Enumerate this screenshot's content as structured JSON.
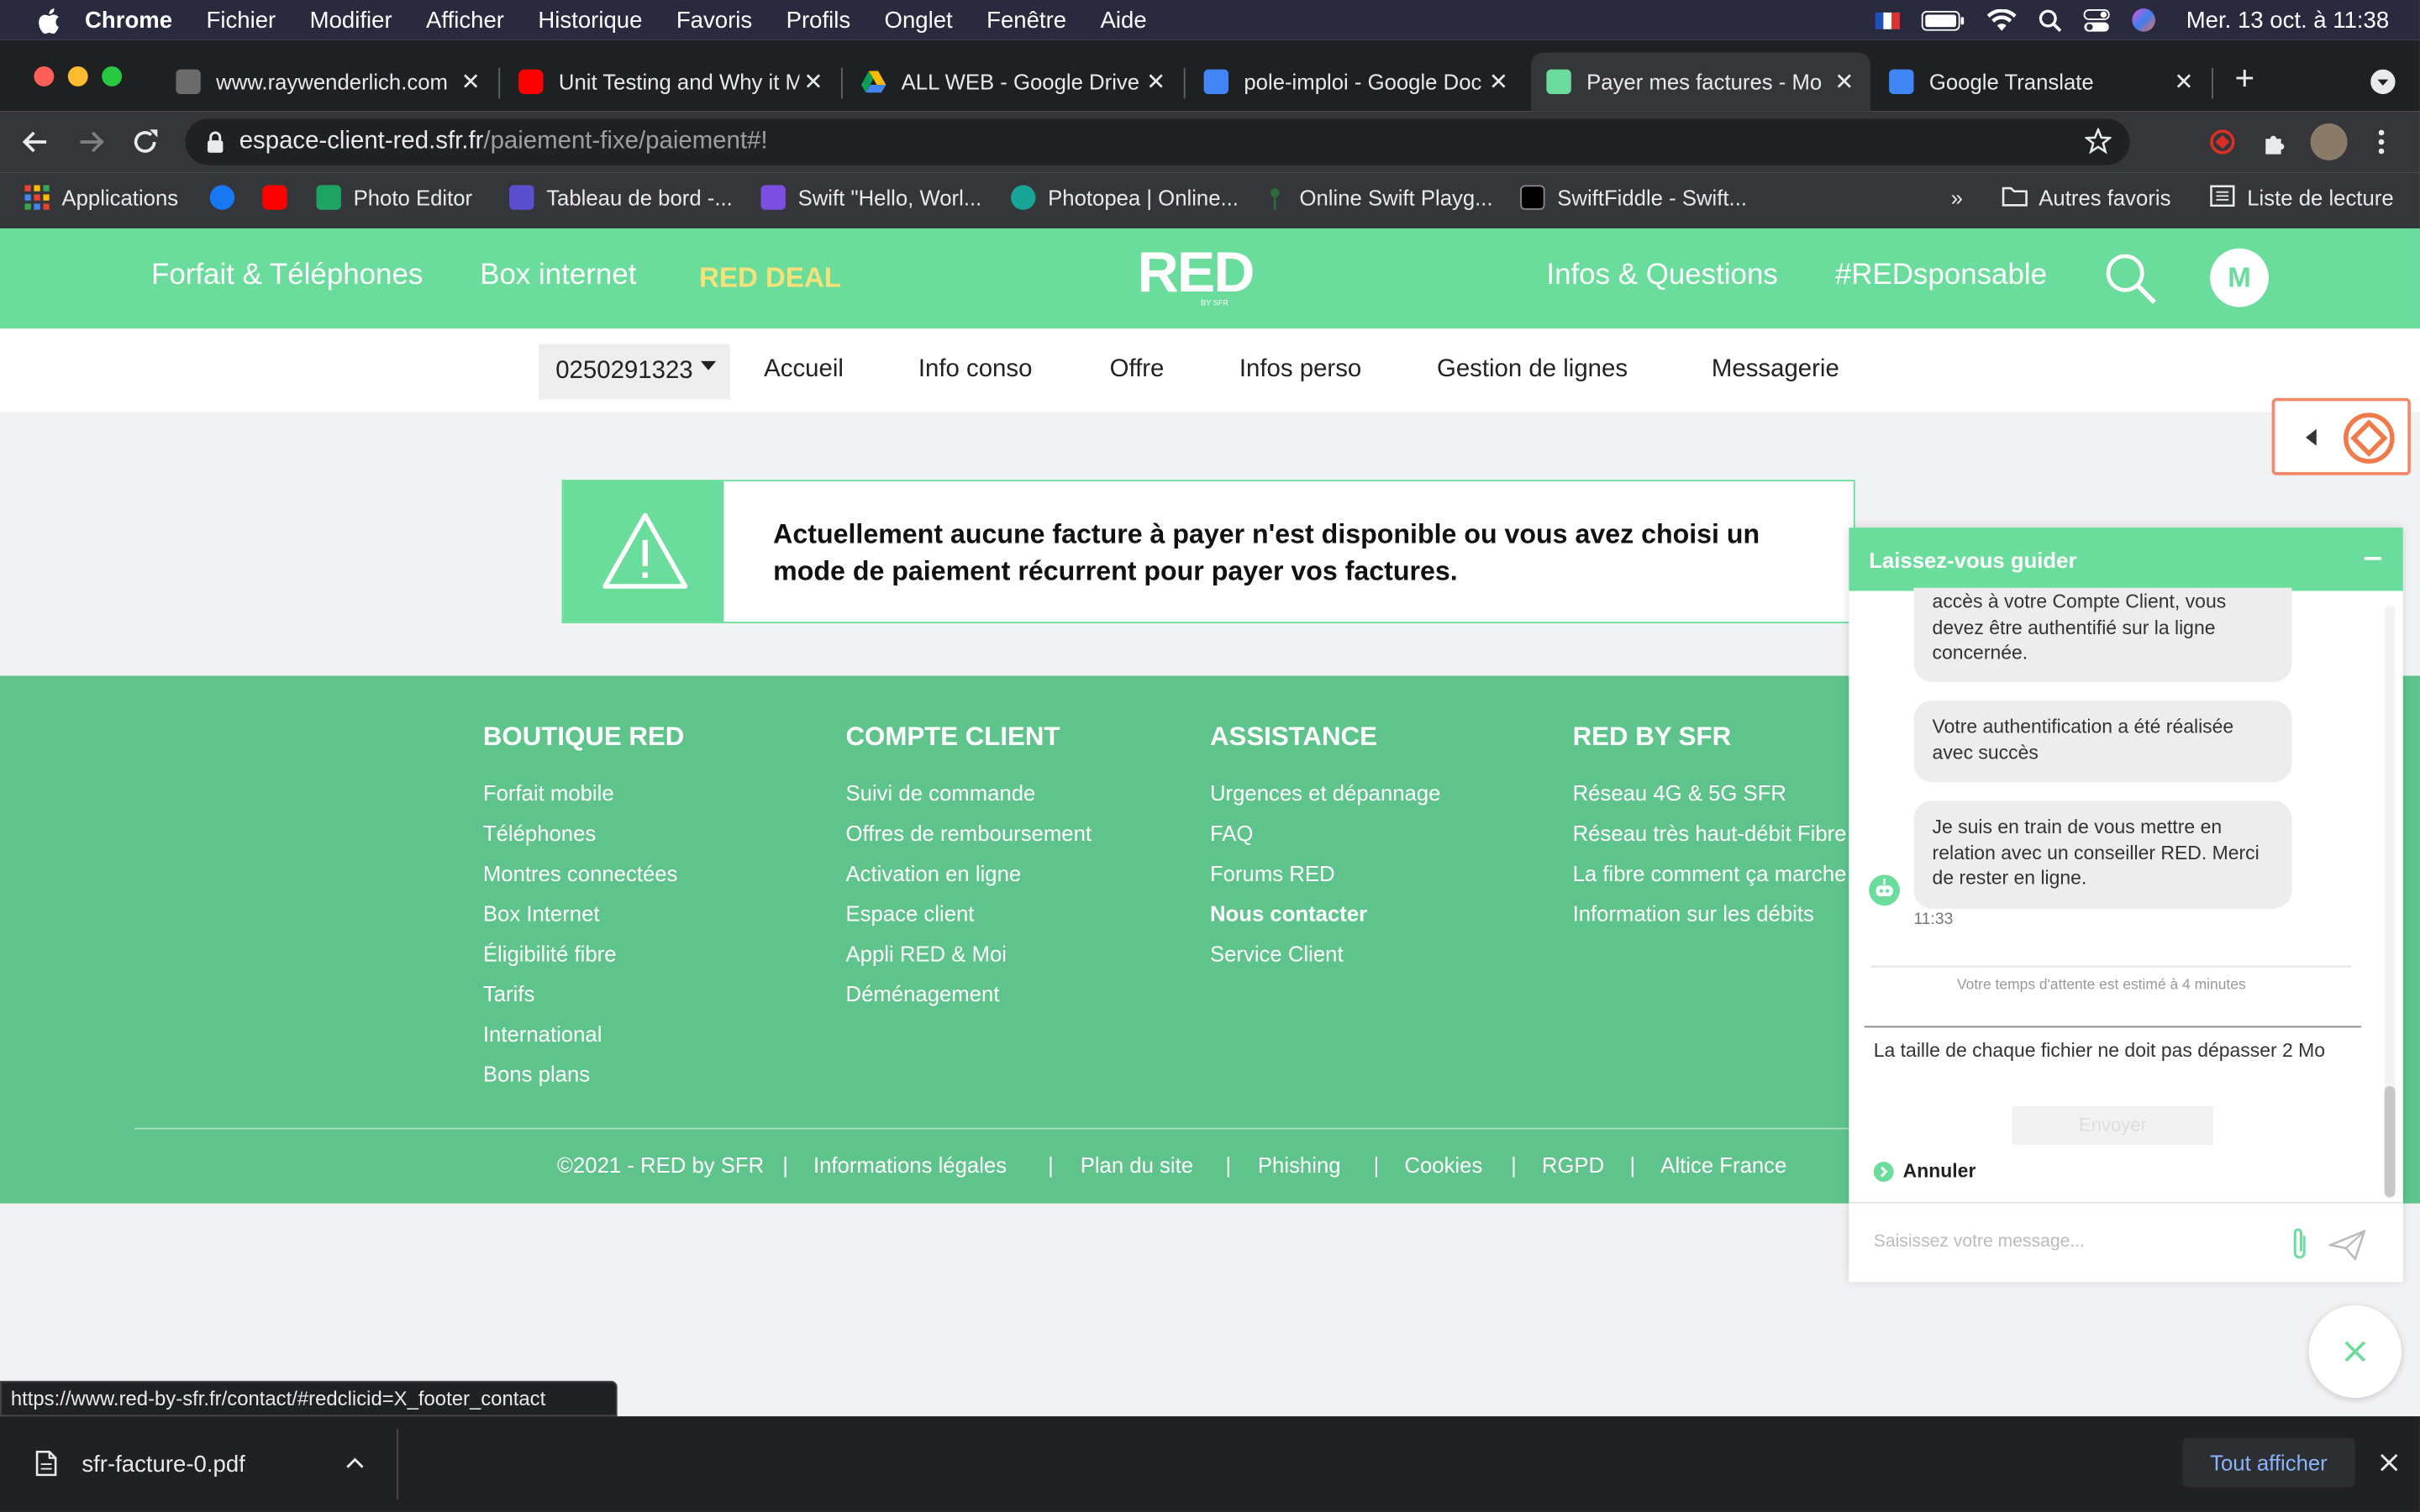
{
  "menubar": {
    "app": "Chrome",
    "items": [
      "Fichier",
      "Modifier",
      "Afficher",
      "Historique",
      "Favoris",
      "Profils",
      "Onglet",
      "Fenêtre",
      "Aide"
    ],
    "clock": "Mer. 13 oct. à  11:38"
  },
  "tabs": [
    {
      "title": "www.raywenderlich.com"
    },
    {
      "title": "Unit Testing and Why it M"
    },
    {
      "title": "ALL WEB - Google Drive"
    },
    {
      "title": "pole-imploi - Google Doc"
    },
    {
      "title": "Payer mes factures - Mo"
    },
    {
      "title": "Google Translate"
    }
  ],
  "omnibox": {
    "host": "espace-client-red.sfr.fr",
    "path": "/paiement-fixe/paiement#!"
  },
  "bookmarks": [
    "Applications",
    "Photo Editor",
    "Tableau de bord -...",
    "Swift \"Hello, Worl...",
    "Photopea | Online...",
    "Online Swift Playg...",
    "SwiftFiddle - Swift...",
    "»",
    "Autres favoris",
    "Liste de lecture"
  ],
  "site": {
    "nav_left": [
      "Forfait & Téléphones",
      "Box internet",
      "RED DEAL"
    ],
    "logo": "RED",
    "logo_sub": "BY SFR",
    "nav_right": [
      "Infos & Questions",
      "#REDsponsable"
    ],
    "avatar": "M",
    "line_number": "0250291323",
    "subnav": [
      "Accueil",
      "Info conso",
      "Offre",
      "Infos perso",
      "Gestion de lignes",
      "Messagerie"
    ],
    "alert": "Actuellement aucune facture à payer n'est disponible ou vous avez choisi un mode de paiement récurrent pour payer vos factures."
  },
  "footer": {
    "columns": [
      {
        "title": "BOUTIQUE RED",
        "links": [
          "Forfait mobile",
          "Téléphones",
          "Montres connectées",
          "Box Internet",
          "Éligibilité fibre",
          "Tarifs",
          "International",
          "Bons plans"
        ]
      },
      {
        "title": "COMPTE CLIENT",
        "links": [
          "Suivi de commande",
          "Offres de remboursement",
          "Activation en ligne",
          "Espace client",
          "Appli RED & Moi",
          "Déménagement"
        ]
      },
      {
        "title": "ASSISTANCE",
        "links": [
          "Urgences et dépannage",
          "FAQ",
          "Forums RED",
          "Nous contacter",
          "Service Client"
        ]
      },
      {
        "title": "RED BY SFR",
        "links": [
          "Réseau 4G & 5G SFR",
          "Réseau très haut-débit Fibre",
          "La fibre comment ça marche",
          "Information sur les débits"
        ]
      }
    ],
    "bottom": [
      "©2021 - RED by SFR",
      "|",
      "Informations légales",
      "|",
      "Plan du site",
      "|",
      "Phishing",
      "|",
      "Cookies",
      "|",
      "RGPD",
      "|",
      "Altice France"
    ]
  },
  "chat": {
    "title": "Laissez-vous guider",
    "messages": [
      "accès à votre Compte Client, vous devez être authentifié sur la ligne concernée.",
      "Votre authentification a été réalisée avec succès",
      "Je suis en train de vous mettre en relation avec un conseiller RED. Merci de rester en ligne."
    ],
    "time": "11:33",
    "wait": "Votre temps d'attente est estimé à 4 minutes",
    "file_note": "La taille de chaque fichier ne doit pas dépasser 2 Mo",
    "send": "Envoyer",
    "cancel": "Annuler",
    "placeholder": "Saisissez votre message..."
  },
  "status_url": "https://www.red-by-sfr.fr/contact/#redclicid=X_footer_contact",
  "download": {
    "file": "sfr-facture-0.pdf",
    "show_all": "Tout afficher"
  },
  "colors": {
    "brand_green": "#6adc9c",
    "footer_green": "#5fc48c",
    "deal_yellow": "#f6e27a"
  }
}
